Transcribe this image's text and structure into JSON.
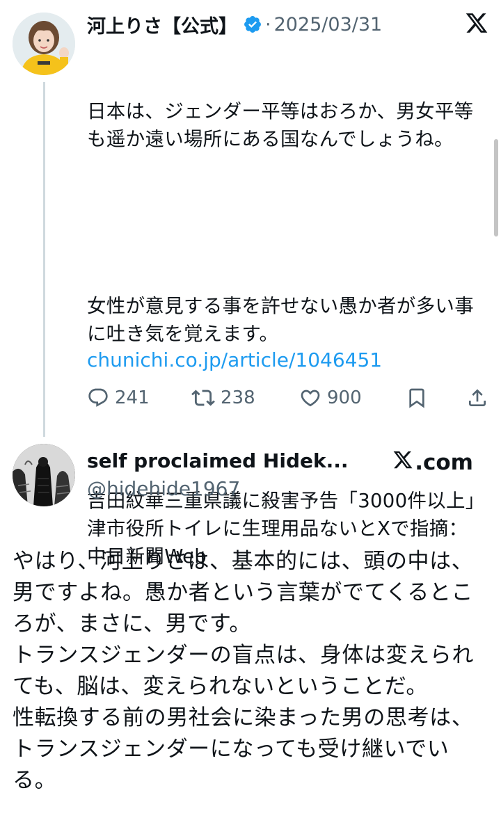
{
  "quoted_tweet": {
    "display_name": "河上りさ【公式】",
    "verified": true,
    "separator": "·",
    "date": "2025/03/31",
    "body_paragraphs": [
      "日本は、ジェンダー平等はおろか、男女平等も遥か遠い場所にある国なんでしょうね。",
      "女性が意見する事を許せない愚か者が多い事に吐き気を覚えます。",
      "吉田紋華三重県議に殺害予告「3000件以上」　津市役所トイレに生理用品ないとXで指摘：中日新聞Web"
    ],
    "link": "chunichi.co.jp/article/1046451",
    "replies": "241",
    "retweets": "238",
    "likes": "900",
    "icons": [
      "reply-icon",
      "retweet-icon",
      "like-icon",
      "bookmark-icon",
      "share-icon",
      "x-logo-icon",
      "verified-badge-icon"
    ]
  },
  "main_tweet": {
    "display_name": "self proclaimed Hidek...",
    "handle": "@hidehide1967",
    "source_label": ".com",
    "body": "やはり、河上りさは、基本的には、頭の中は、男ですよね。愚か者という言葉がでてくるところが、まさに、男です。\nトランスジェンダーの盲点は、身体は変えられても、脳は、変えられないということだ。\n性転換する前の男社会に染まった男の思考は、トランスジェンダーになっても受け継いでいる。"
  },
  "colors": {
    "link": "#1d9bf0",
    "secondary_text": "#536471",
    "primary_text": "#0f1419",
    "verified": "#1d9bf0",
    "thread_line": "#cfd9de"
  }
}
